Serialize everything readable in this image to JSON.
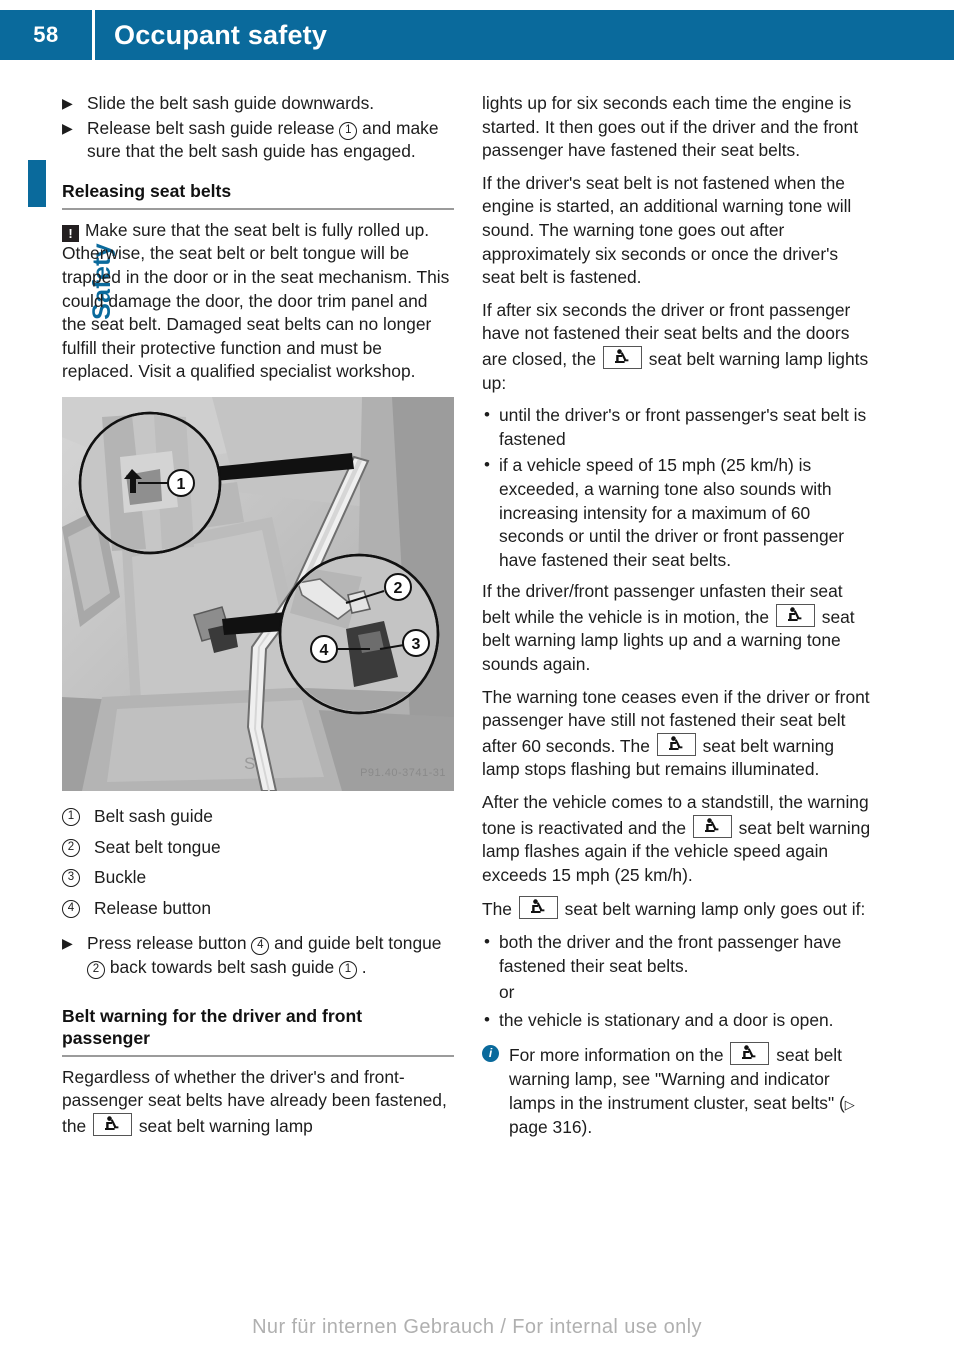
{
  "header": {
    "page_number": "58",
    "title": "Occupant safety"
  },
  "side_tab": {
    "label": "Safety"
  },
  "colors": {
    "brand_blue": "#0a6a9c",
    "rule_gray": "#9b9b9b",
    "warning_black": "#231f20"
  },
  "icons": {
    "step_arrow": "▶",
    "bullet_dot": "•",
    "warning": "!",
    "info": "i",
    "page_ref_arrow": "▷",
    "seat_belt_lamp": "seat-belt-warning-lamp"
  },
  "left_column": {
    "steps_top": [
      {
        "parts": [
          {
            "type": "text",
            "value": "Slide the belt sash guide downwards."
          }
        ]
      },
      {
        "parts": [
          {
            "type": "text",
            "value": "Release belt sash guide release "
          },
          {
            "type": "circled",
            "value": "1"
          },
          {
            "type": "text",
            "value": " and make sure that the belt sash guide has engaged."
          }
        ]
      }
    ],
    "section_heading": "Releasing seat belts",
    "warning_text": "Make sure that the seat belt is fully rolled up. Otherwise, the seat belt or belt tongue will be trapped in the door or in the seat mechanism. This could damage the door, the door trim panel and the seat belt. Damaged seat belts can no longer fulfill their protective function and must be replaced. Visit a qualified specialist workshop.",
    "figure": {
      "alt": "Vehicle interior showing seat belt with two magnified callout circles",
      "watermark": "P91.40-3741-31",
      "callouts": [
        "1",
        "2",
        "3",
        "4"
      ]
    },
    "legend": [
      {
        "number": "1",
        "label": "Belt sash guide"
      },
      {
        "number": "2",
        "label": "Seat belt tongue"
      },
      {
        "number": "3",
        "label": "Buckle"
      },
      {
        "number": "4",
        "label": "Release button"
      }
    ],
    "step_after_legend": {
      "parts": [
        {
          "type": "text",
          "value": "Press release button "
        },
        {
          "type": "circled",
          "value": "4"
        },
        {
          "type": "text",
          "value": " and guide belt tongue "
        },
        {
          "type": "circled",
          "value": "2"
        },
        {
          "type": "text",
          "value": " back towards belt sash guide "
        },
        {
          "type": "circled",
          "value": "1"
        },
        {
          "type": "text",
          "value": " ."
        }
      ]
    },
    "section_heading_2": "Belt warning for the driver and front passenger",
    "para_bottom": {
      "parts": [
        {
          "type": "text",
          "value": "Regardless of whether the driver's and front-passenger seat belts have already been fastened, the "
        },
        {
          "type": "lamp"
        },
        {
          "type": "text",
          "value": " seat belt warning lamp"
        }
      ]
    }
  },
  "right_column": {
    "para_1": "lights up for six seconds each time the engine is started. It then goes out if the driver and the front passenger have fastened their seat belts.",
    "para_2": "If the driver's seat belt is not fastened when the engine is started, an additional warning tone will sound. The warning tone goes out after approximately six seconds or once the driver's seat belt is fastened.",
    "para_3": {
      "parts": [
        {
          "type": "text",
          "value": "If after six seconds the driver or front passenger have not fastened their seat belts and the doors are closed, the "
        },
        {
          "type": "lamp"
        },
        {
          "type": "text",
          "value": " seat belt warning lamp lights up:"
        }
      ]
    },
    "bullets_1": [
      "until the driver's or front passenger's seat belt is fastened",
      "if a vehicle speed of 15 mph (25 km/h) is exceeded, a warning tone also sounds with increasing intensity for a maximum of 60 seconds or until the driver or front passenger have fastened their seat belts."
    ],
    "para_4": {
      "parts": [
        {
          "type": "text",
          "value": "If the driver/front passenger unfasten their seat belt while the vehicle is in motion, the "
        },
        {
          "type": "lamp"
        },
        {
          "type": "text",
          "value": " seat belt warning lamp lights up and a warning tone sounds again."
        }
      ]
    },
    "para_5": {
      "parts": [
        {
          "type": "text",
          "value": "The warning tone ceases even if the driver or front passenger have still not fastened their seat belt after 60 seconds. The "
        },
        {
          "type": "lamp"
        },
        {
          "type": "text",
          "value": " seat belt warning lamp stops flashing but remains illuminated."
        }
      ]
    },
    "para_6": {
      "parts": [
        {
          "type": "text",
          "value": "After the vehicle comes to a standstill, the warning tone is reactivated and the "
        },
        {
          "type": "lamp"
        },
        {
          "type": "text",
          "value": " seat belt warning lamp flashes again if the vehicle speed again exceeds 15 mph (25 km/h)."
        }
      ]
    },
    "para_7": {
      "parts": [
        {
          "type": "text",
          "value": "The "
        },
        {
          "type": "lamp"
        },
        {
          "type": "text",
          "value": " seat belt warning lamp only goes out if:"
        }
      ]
    },
    "bullets_2": [
      "both the driver and the front passenger have fastened their seat belts."
    ],
    "or_label": "or",
    "bullets_3": [
      "the vehicle is stationary and a door is open."
    ],
    "info_note": {
      "parts": [
        {
          "type": "text",
          "value": "For more information on the "
        },
        {
          "type": "lamp"
        },
        {
          "type": "text",
          "value": " seat belt warning lamp, see \"Warning and indicator lamps in the instrument cluster, seat belts\" ("
        },
        {
          "type": "pageref",
          "value": "page 316"
        },
        {
          "type": "text",
          "value": ")."
        }
      ]
    }
  },
  "footer": {
    "watermark": "Nur für internen Gebrauch / For internal use only"
  }
}
